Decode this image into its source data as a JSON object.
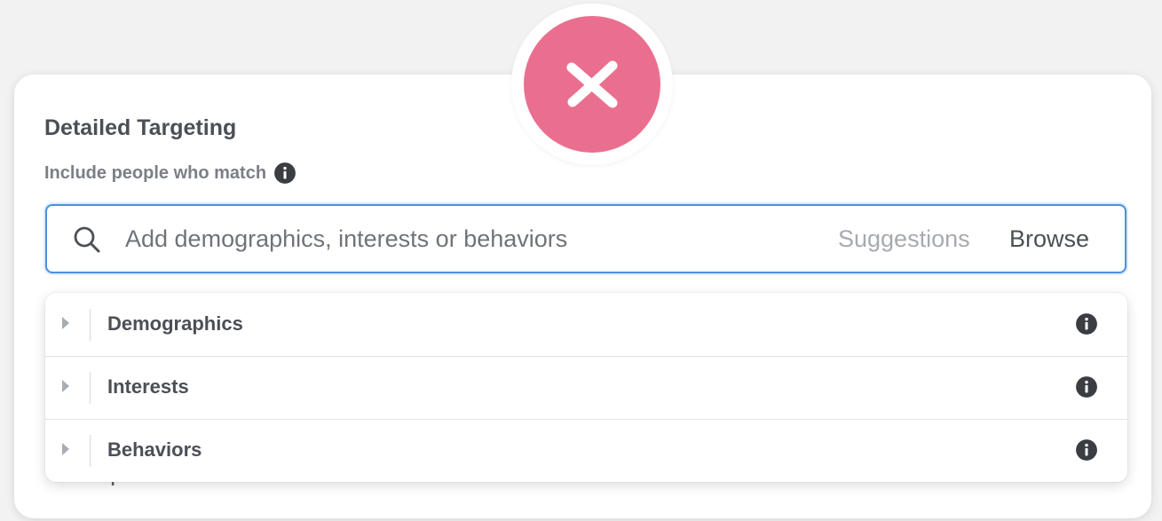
{
  "badge": {
    "icon": "close-x-icon",
    "color": "#ea6f8f"
  },
  "panel": {
    "title": "Detailed Targeting",
    "subtitle": "Include people who match",
    "subtitle_icon": "info-icon"
  },
  "search": {
    "icon": "search-icon",
    "placeholder": "Add demographics, interests or behaviors",
    "value": "",
    "suggestions_label": "Suggestions",
    "browse_label": "Browse",
    "accent_color": "#4a90e2"
  },
  "categories": [
    {
      "label": "Demographics",
      "icon": "info-icon"
    },
    {
      "label": "Interests",
      "icon": "info-icon"
    },
    {
      "label": "Behaviors",
      "icon": "info-icon"
    }
  ],
  "background_text": "performance."
}
